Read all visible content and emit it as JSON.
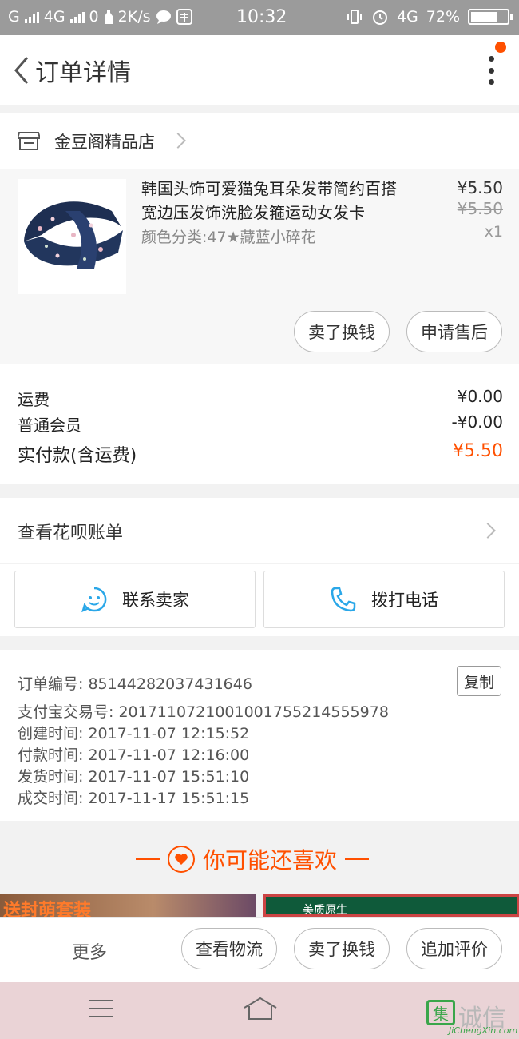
{
  "status_bar": {
    "carrier": "G",
    "network": "4G",
    "network2": "0",
    "speed": "2K/s",
    "time": "10:32",
    "battery_network": "4G",
    "battery_percent": "72%",
    "battery_level": 0.72
  },
  "header": {
    "title": "订单详情"
  },
  "shop": {
    "name": "金豆阁精品店"
  },
  "product": {
    "title": "韩国头饰可爱猫兔耳朵发带简约百搭宽边压发饰洗脸发箍运动女发卡",
    "sku": "颜色分类:47★藏蓝小碎花",
    "price": "¥5.50",
    "original_price": "¥5.50",
    "quantity": "x1",
    "actions": [
      "卖了换钱",
      "申请售后"
    ]
  },
  "fees": {
    "shipping_label": "运费",
    "shipping_value": "¥0.00",
    "member_label": "普通会员",
    "member_value": "-¥0.00",
    "total_label": "实付款(含运费)",
    "total_value": "¥5.50"
  },
  "huabei": {
    "label": "查看花呗账单"
  },
  "contact": {
    "seller_label": "联系卖家",
    "phone_label": "拨打电话"
  },
  "order_info": {
    "lines": [
      "订单编号: 85144282037431646",
      "支付宝交易号: 2017110721001001755214555978",
      "创建时间: 2017-11-07  12:15:52",
      "付款时间: 2017-11-07  12:16:00",
      "发货时间: 2017-11-07  15:51:10",
      "成交时间: 2017-11-17  15:51:15"
    ],
    "copy_label": "复制"
  },
  "recommend": {
    "title": "你可能还喜欢",
    "left_teaser": "送封萌套装",
    "right_teaser": "美质原生"
  },
  "bottom_bar": {
    "more_label": "更多",
    "actions": [
      "查看物流",
      "卖了换钱",
      "追加评价"
    ]
  },
  "watermark": {
    "logo": "集",
    "text": "诚信",
    "url": "JiChengXin.com"
  },
  "colors": {
    "accent": "#ff5000",
    "status_bar": "#9b9b9b",
    "sys_nav": "#ead3d6",
    "watermark_green": "#3aa64a"
  }
}
